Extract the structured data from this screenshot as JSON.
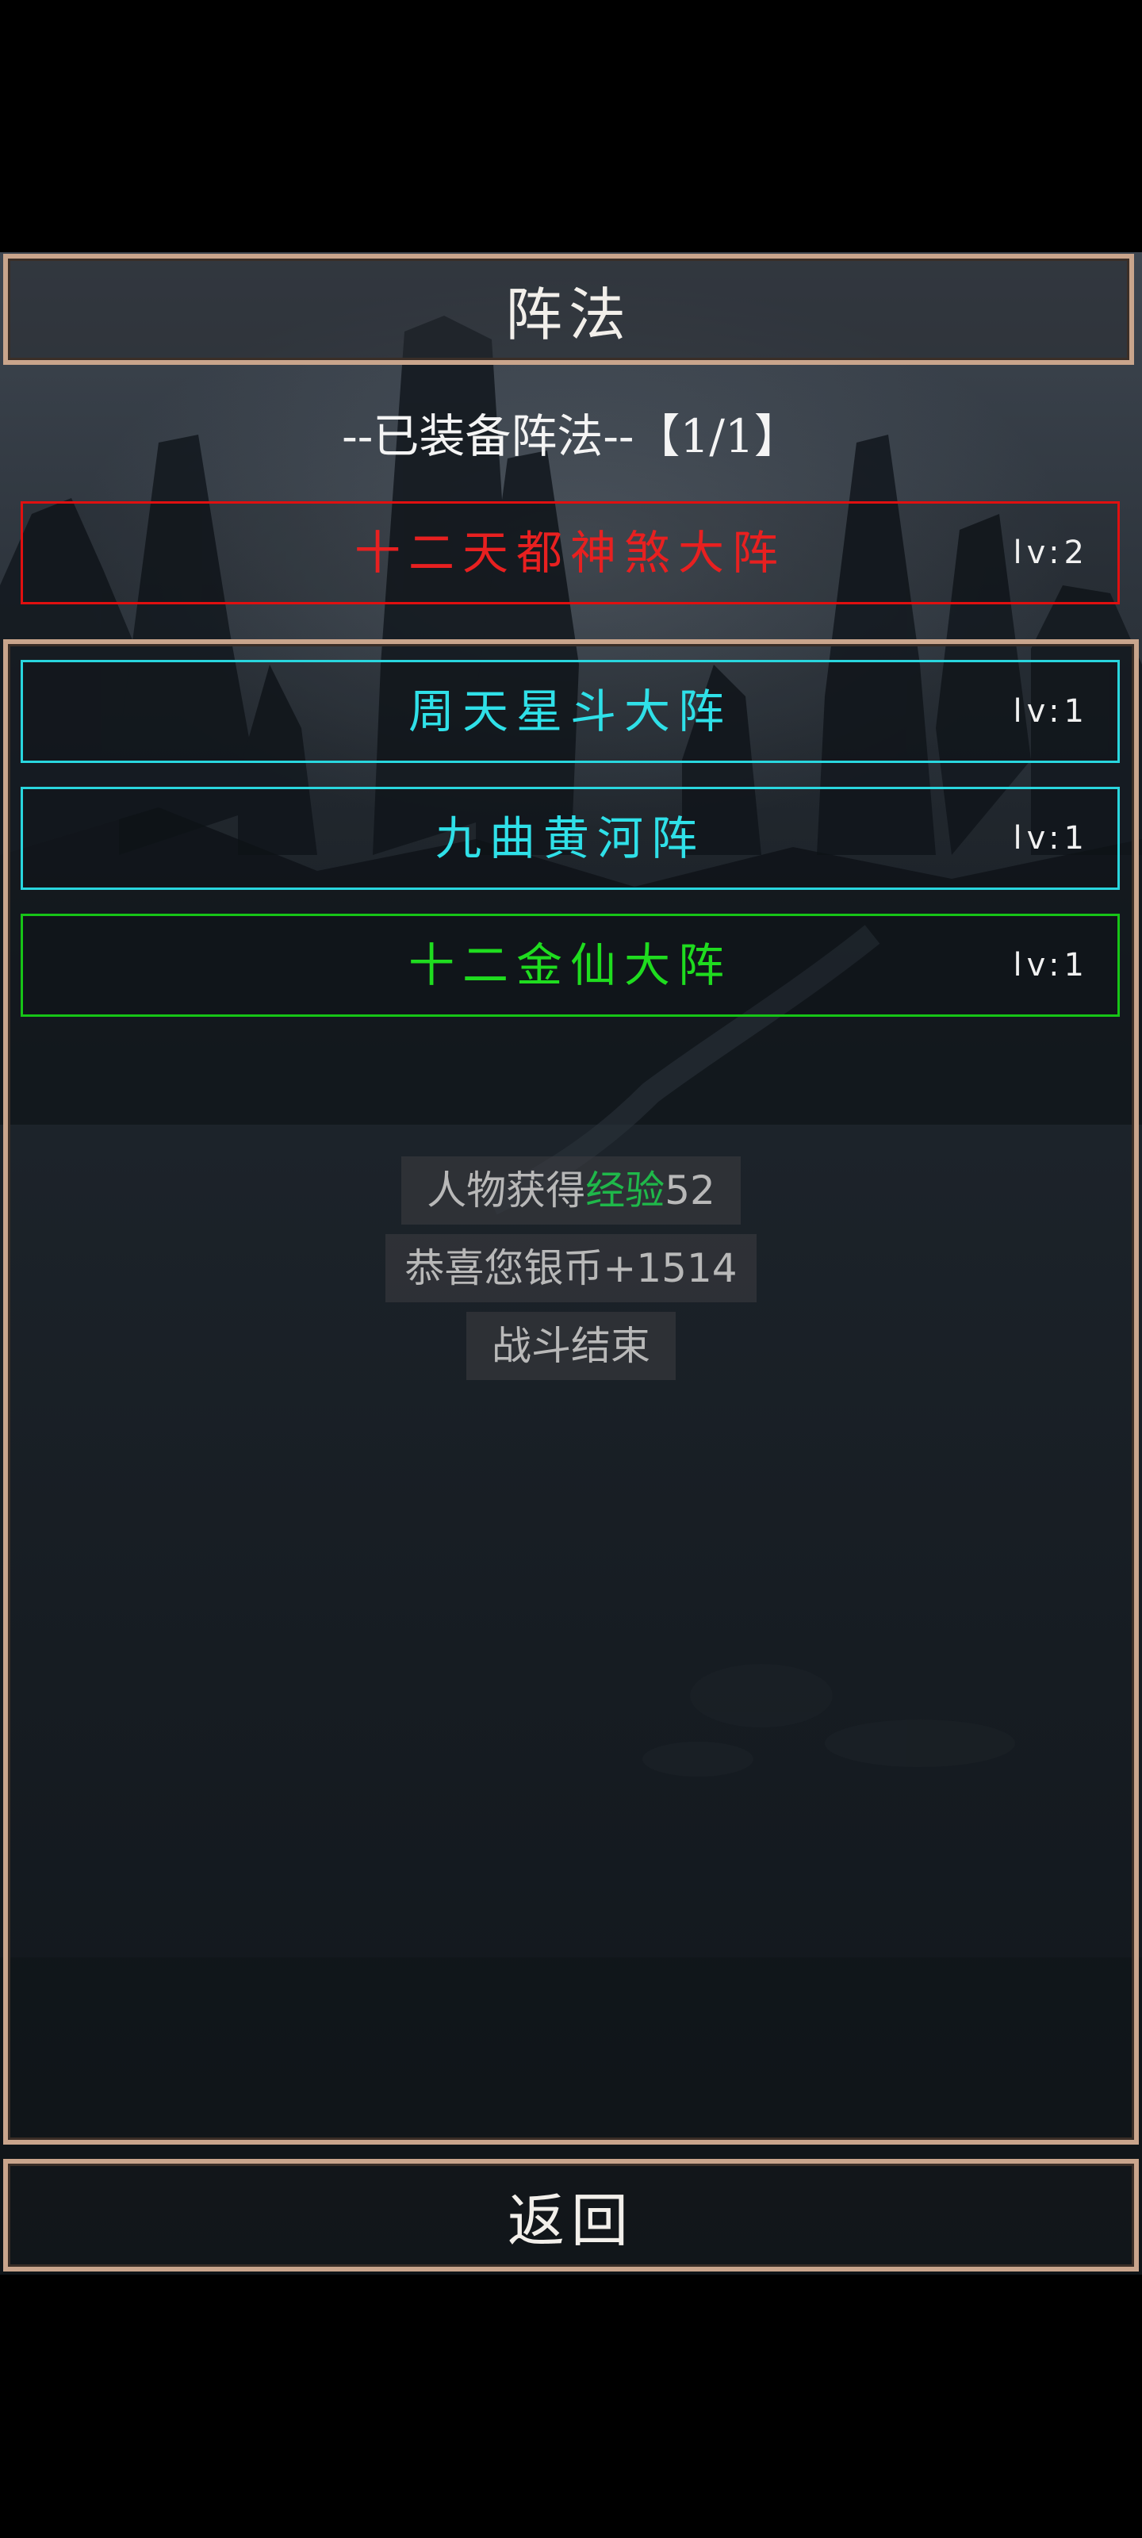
{
  "title": "阵法",
  "equipped_header": "--已装备阵法--【1/1】",
  "equipped": {
    "name": "十二天都神煞大阵",
    "level": "lv:2",
    "color": "#e82020"
  },
  "formations": [
    {
      "name": "周天星斗大阵",
      "level": "lv:1",
      "color": "#2fe0e8"
    },
    {
      "name": "九曲黄河阵",
      "level": "lv:1",
      "color": "#2fe0e8"
    },
    {
      "name": "十二金仙大阵",
      "level": "lv:1",
      "color": "#1fdc1f"
    }
  ],
  "messages": {
    "exp_prefix": "人物获得",
    "exp_word": "经验",
    "exp_value": "52",
    "silver": "恭喜您银币+1514",
    "battle_end": "战斗结束"
  },
  "back_label": "返回",
  "colors": {
    "frame": "#c9a58c",
    "exp_highlight": "#1fb84a"
  }
}
